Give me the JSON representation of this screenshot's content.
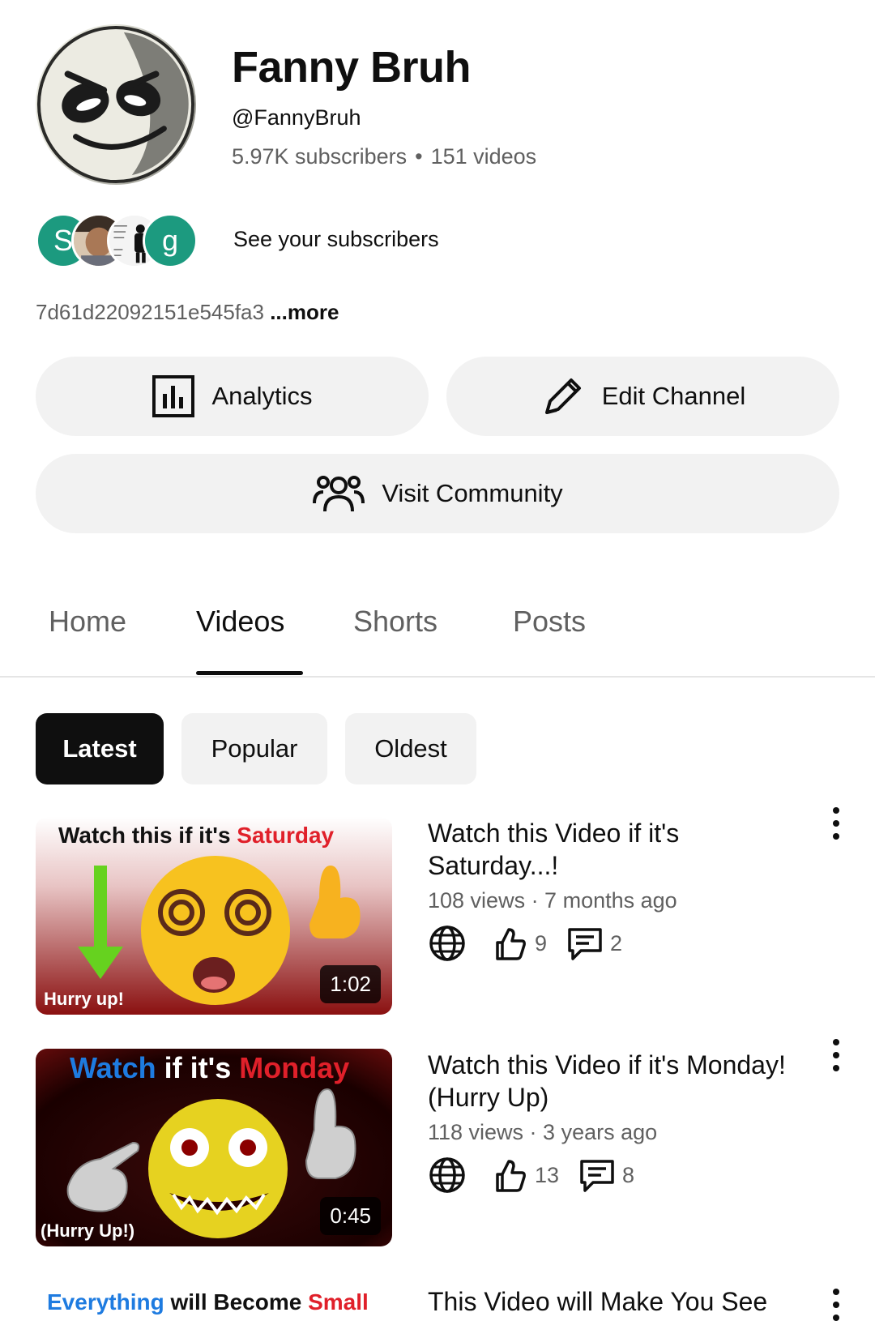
{
  "channel": {
    "name": "Fanny Bruh",
    "handle": "@FannyBruh",
    "subscribers": "5.97K subscribers",
    "separator": "•",
    "videos": "151 videos",
    "subscriber_avatars": [
      {
        "letter": "S",
        "color": "#1c9a7f"
      },
      {
        "letter": "",
        "color": "#c9b39b"
      },
      {
        "letter": "",
        "color": "#f4f4f4"
      },
      {
        "letter": "g",
        "color": "#1c9a7f"
      }
    ],
    "see_subscribers": "See your subscribers",
    "description": "7d61d22092151e545fa3",
    "more": "...more"
  },
  "actions": {
    "analytics": "Analytics",
    "edit_channel": "Edit Channel",
    "visit_community": "Visit Community"
  },
  "tabs": [
    {
      "label": "Home",
      "active": false
    },
    {
      "label": "Videos",
      "active": true
    },
    {
      "label": "Shorts",
      "active": false
    },
    {
      "label": "Posts",
      "active": false
    }
  ],
  "filters": [
    {
      "label": "Latest",
      "active": true
    },
    {
      "label": "Popular",
      "active": false
    },
    {
      "label": "Oldest",
      "active": false
    }
  ],
  "videos": [
    {
      "thumb_top_a": "Watch this if it's ",
      "thumb_top_b": "Saturday",
      "thumb_bottom": "Hurry up!",
      "duration": "1:02",
      "title": "Watch this Video if it's Saturday...!",
      "meta": "108 views · 7 months ago",
      "likes": "9",
      "comments": "2"
    },
    {
      "thumb_top_a": "Watch",
      "thumb_top_b": " if it's ",
      "thumb_top_c": "Monday",
      "thumb_bottom": "(Hurry Up!)",
      "duration": "0:45",
      "title": "Watch this Video if it's Monday! (Hurry Up)",
      "meta": "118 views · 3 years ago",
      "likes": "13",
      "comments": "8"
    },
    {
      "thumb_top_a": "Everything",
      "thumb_top_b": " will ",
      "thumb_top_c": "Become",
      "thumb_top_d": " Small",
      "title": "This Video will Make You See"
    }
  ],
  "colors": {
    "accent_teal": "#1c9a7f",
    "chip_bg": "#f2f2f2",
    "text_secondary": "#606060",
    "thumb_red": "#e0202a",
    "thumb_blue": "#1e7be0"
  }
}
